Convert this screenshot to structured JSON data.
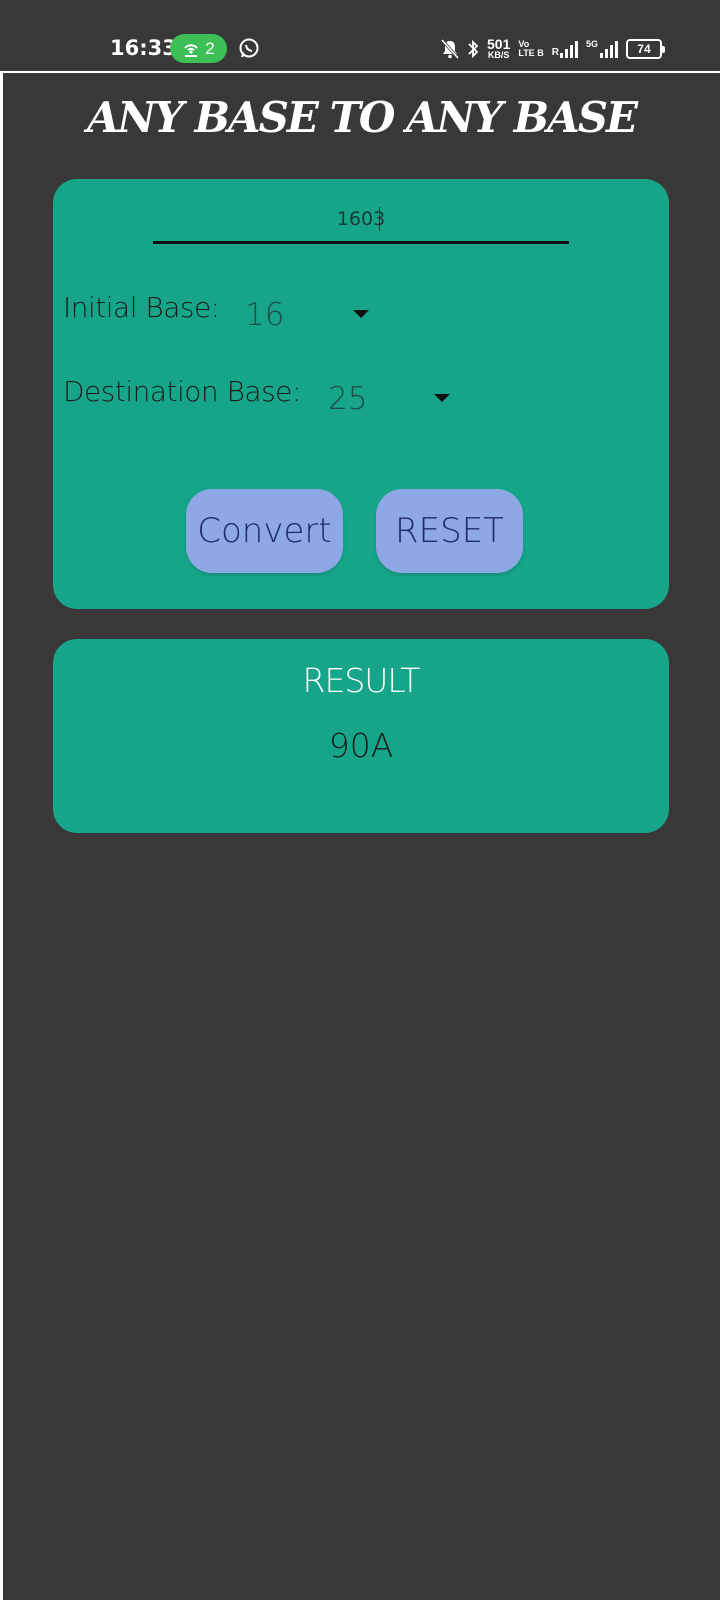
{
  "status_bar": {
    "time": "16:33",
    "hotspot_count": "2",
    "net_speed_value": "501",
    "net_speed_unit": "KB/S",
    "volte_top": "Vo",
    "volte_bottom": "LTE B",
    "roaming_mark": "R",
    "network_type": "5G",
    "battery_level": "74",
    "icons": [
      "hotspot-icon",
      "whatsapp-icon",
      "mute-icon",
      "bluetooth-icon",
      "signal-icon",
      "battery-icon"
    ]
  },
  "app": {
    "title": "ANY BASE TO ANY BASE",
    "input": {
      "value": "1603",
      "placeholder": ""
    },
    "initial_base": {
      "label": "Initial Base:",
      "selected": "16"
    },
    "destination_base": {
      "label": "Destination Base:",
      "selected": "25"
    },
    "buttons": {
      "convert": "Convert",
      "reset": "RESET"
    },
    "result": {
      "heading": "RESULT",
      "value": "90A"
    }
  },
  "colors": {
    "background": "#383838",
    "card": "#16a589",
    "button": "#8ea8e6",
    "button_text": "#1f2a6b",
    "hotspot_pill": "#3cbf55"
  }
}
